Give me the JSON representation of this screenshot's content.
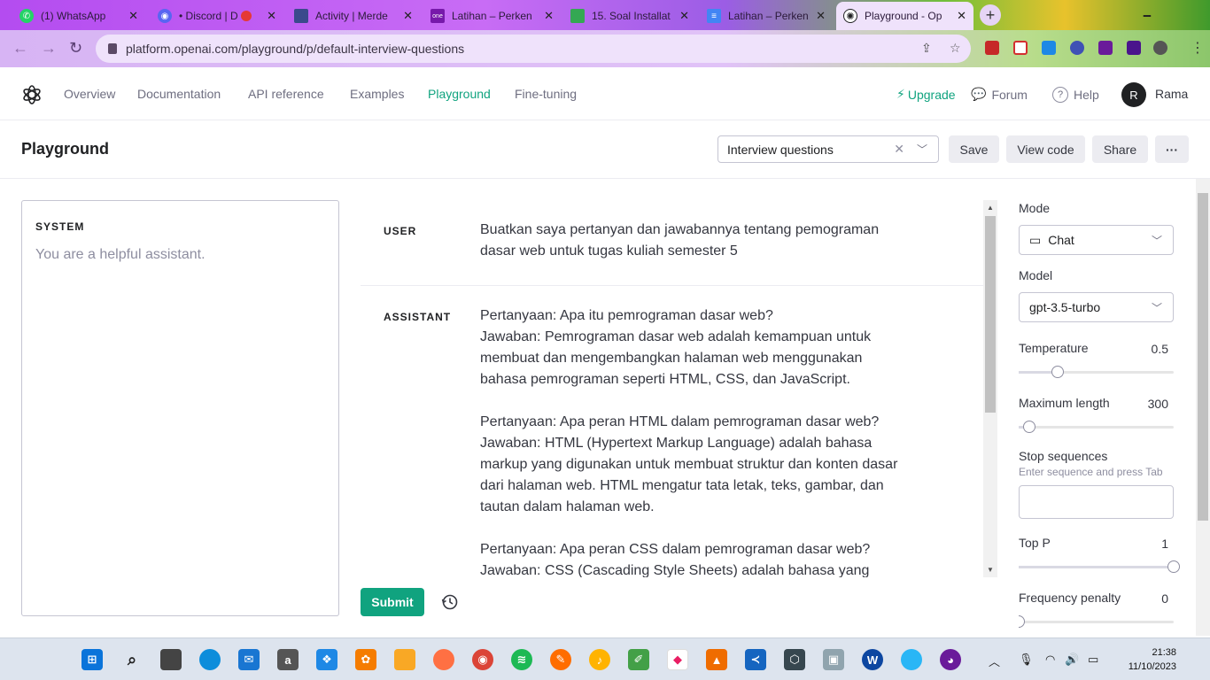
{
  "browser": {
    "tabs": [
      {
        "label": "(1) WhatsApp",
        "icon": "whatsapp-icon",
        "color": "#25d366"
      },
      {
        "label": "• Discord | D",
        "icon": "discord-icon",
        "color": "#5865f2"
      },
      {
        "label": "Activity | Merde",
        "icon": "merdeka-icon",
        "color": "#3b4a8c"
      },
      {
        "label": "Latihan – Perken",
        "icon": "onenote-icon",
        "color": "#7719aa"
      },
      {
        "label": "15. Soal Installat",
        "icon": "sheets-icon",
        "color": "#34a853"
      },
      {
        "label": "Latihan – Perken",
        "icon": "docs-icon",
        "color": "#4285f4"
      },
      {
        "label": "Playground - Op",
        "icon": "openai-icon",
        "color": "#202123"
      }
    ],
    "url": "platform.openai.com/playground/p/default-interview-questions"
  },
  "nav": {
    "links": [
      "Overview",
      "Documentation",
      "API reference",
      "Examples",
      "Playground",
      "Fine-tuning"
    ],
    "upgrade": "Upgrade",
    "forum": "Forum",
    "help": "Help",
    "avatar_initial": "R",
    "user_name": "Rama"
  },
  "header": {
    "title": "Playground",
    "preset": "Interview questions",
    "save": "Save",
    "view_code": "View code",
    "share": "Share",
    "more": "···"
  },
  "system": {
    "label": "SYSTEM",
    "text": "You are a helpful assistant."
  },
  "messages": {
    "user_role": "USER",
    "user_text": "Buatkan saya pertanyan dan jawabannya tentang pemograman\ndasar web untuk tugas kuliah semester 5",
    "assistant_role": "ASSISTANT",
    "assistant_text": "Pertanyaan: Apa itu pemrograman dasar web?\nJawaban: Pemrograman dasar web adalah kemampuan untuk\nmembuat dan mengembangkan halaman web menggunakan\nbahasa pemrograman seperti HTML, CSS, dan JavaScript.\n\nPertanyaan: Apa peran HTML dalam pemrograman dasar web?\nJawaban: HTML (Hypertext Markup Language) adalah bahasa\nmarkup yang digunakan untuk membuat struktur dan konten dasar\ndari halaman web. HTML mengatur tata letak, teks, gambar, dan\ntautan dalam halaman web.\n\nPertanyaan: Apa peran CSS dalam pemrograman dasar web?\nJawaban: CSS (Cascading Style Sheets) adalah bahasa yang"
  },
  "submit": "Submit",
  "settings": {
    "mode_label": "Mode",
    "mode_value": "Chat",
    "model_label": "Model",
    "model_value": "gpt-3.5-turbo",
    "temperature_label": "Temperature",
    "temperature_value": "0.5",
    "temperature_fraction": 0.25,
    "max_length_label": "Maximum length",
    "max_length_value": "300",
    "max_length_fraction": 0.07,
    "stop_label": "Stop sequences",
    "stop_hint": "Enter sequence and press Tab",
    "top_p_label": "Top P",
    "top_p_value": "1",
    "top_p_fraction": 1.0,
    "freq_label": "Frequency penalty",
    "freq_value": "0",
    "freq_fraction": 0.0
  },
  "taskbar": {
    "time": "21:38",
    "date": "11/10/2023"
  },
  "colors": {
    "accent": "#10a37f",
    "text": "#353740",
    "muted": "#8e8ea0"
  }
}
